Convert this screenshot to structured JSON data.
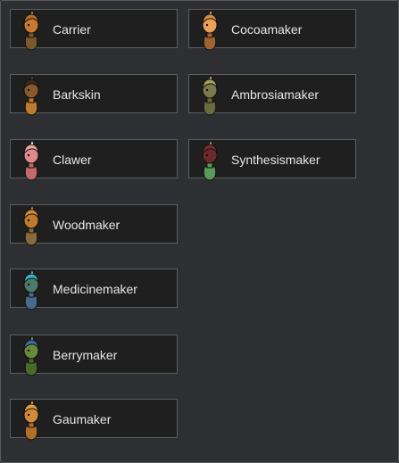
{
  "cards": [
    {
      "label": "Carrier",
      "icon": "carrier-portrait-icon",
      "head": "#c97a32",
      "body": "#7a5a2c",
      "hair": "#b56a28",
      "accent": "#d08a40"
    },
    {
      "label": "Cocoamaker",
      "icon": "cocoamaker-portrait-icon",
      "head": "#e8a05a",
      "body": "#a0652e",
      "hair": "#d68a40",
      "accent": "#f0b070"
    },
    {
      "label": "Barkskin",
      "icon": "barkskin-portrait-icon",
      "head": "#8a5a2e",
      "body": "#c07a2e",
      "hair": "#3a2a1e",
      "accent": "#6a4422"
    },
    {
      "label": "Ambrosiamaker",
      "icon": "ambrosiamaker-portrait-icon",
      "head": "#7a7a4a",
      "body": "#6a6a3c",
      "hair": "#a8a060",
      "accent": "#d0c070"
    },
    {
      "label": "Clawer",
      "icon": "clawer-portrait-icon",
      "head": "#e08a8a",
      "body": "#c06a6a",
      "hair": "#f0a0a0",
      "accent": "#ffffff"
    },
    {
      "label": "Synthesismaker",
      "icon": "synthesismaker-portrait-icon",
      "head": "#6a2a2a",
      "body": "#5a9a5a",
      "hair": "#7a2a2a",
      "accent": "#7ac07a"
    },
    {
      "label": "Woodmaker",
      "icon": "woodmaker-portrait-icon",
      "head": "#c07a2e",
      "body": "#8a6a3c",
      "hair": "#d08a3a",
      "accent": "#e09a4a"
    },
    {
      "label": "Medicinemaker",
      "icon": "medicinemaker-portrait-icon",
      "head": "#4a7a6a",
      "body": "#4a6a8a",
      "hair": "#3ab0c0",
      "accent": "#6ac0d0"
    },
    {
      "label": "Berrymaker",
      "icon": "berrymaker-portrait-icon",
      "head": "#6a8a3a",
      "body": "#4a6a2a",
      "hair": "#3a6aa0",
      "accent": "#8aa04a"
    },
    {
      "label": "Gaumaker",
      "icon": "gaumaker-portrait-icon",
      "head": "#d08a3a",
      "body": "#b0702a",
      "hair": "#e0a04a",
      "accent": "#f0c060"
    }
  ]
}
